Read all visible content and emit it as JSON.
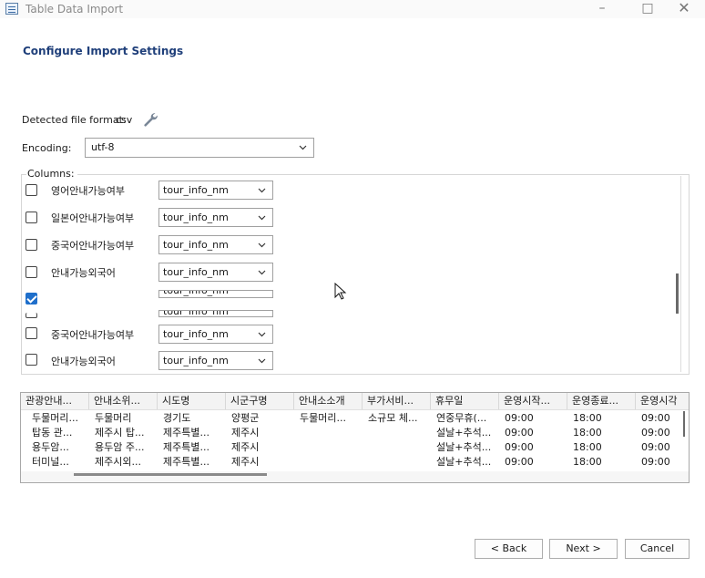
{
  "window": {
    "title": "Table Data Import"
  },
  "heading": "Configure Import Settings",
  "file_format": {
    "label": "Detected file format:",
    "value": "csv"
  },
  "encoding": {
    "label": "Encoding:",
    "value": "utf-8"
  },
  "columns": {
    "title": "Columns:",
    "rows": [
      {
        "name": "영어안내가능여부",
        "type": "tour_info_nm",
        "checked": false
      },
      {
        "name": "일본어안내가능여부",
        "type": "tour_info_nm",
        "checked": false
      },
      {
        "name": "중국어안내가능여부",
        "type": "tour_info_nm",
        "checked": false
      },
      {
        "name": "안내가능외국어",
        "type": "tour_info_nm",
        "checked": false
      },
      {
        "name": "",
        "type": "tour_info_nm",
        "checked": true
      },
      {
        "name": "",
        "type": "tour_info_nm",
        "checked": false
      },
      {
        "name": "중국어안내가능여부",
        "type": "tour_info_nm",
        "checked": false
      },
      {
        "name": "안내가능외국어",
        "type": "tour_info_nm",
        "checked": false
      }
    ]
  },
  "preview": {
    "headers": [
      "관광안내...",
      "안내소위...",
      "시도명",
      "시군구명",
      "안내소소개",
      "부가서비...",
      "휴무일",
      "운영시작...",
      "운영종료...",
      "운영시각"
    ],
    "rows": [
      [
        "두물머리...",
        "두물머리",
        "경기도",
        "양평군",
        "두물머리...",
        "소규모 체...",
        "연중무휴(...",
        "09:00",
        "18:00",
        "09:00"
      ],
      [
        "탑동 관...",
        "제주시 탑...",
        "제주특별...",
        "제주시",
        "",
        "",
        "설날+추석...",
        "09:00",
        "18:00",
        "09:00"
      ],
      [
        "용두암...",
        "용두암 주...",
        "제주특별...",
        "제주시",
        "",
        "",
        "설날+추석...",
        "09:00",
        "18:00",
        "09:00"
      ],
      [
        "터미널...",
        "제주시외...",
        "제주특별...",
        "제주시",
        "",
        "",
        "설날+추석...",
        "09:00",
        "18:00",
        "09:00"
      ]
    ]
  },
  "buttons": {
    "back": "< Back",
    "next": "Next >",
    "cancel": "Cancel"
  },
  "icons": {
    "wrench": "wrench-icon",
    "chevron": "chevron-down-icon",
    "cursor": "mouse-cursor-icon"
  }
}
